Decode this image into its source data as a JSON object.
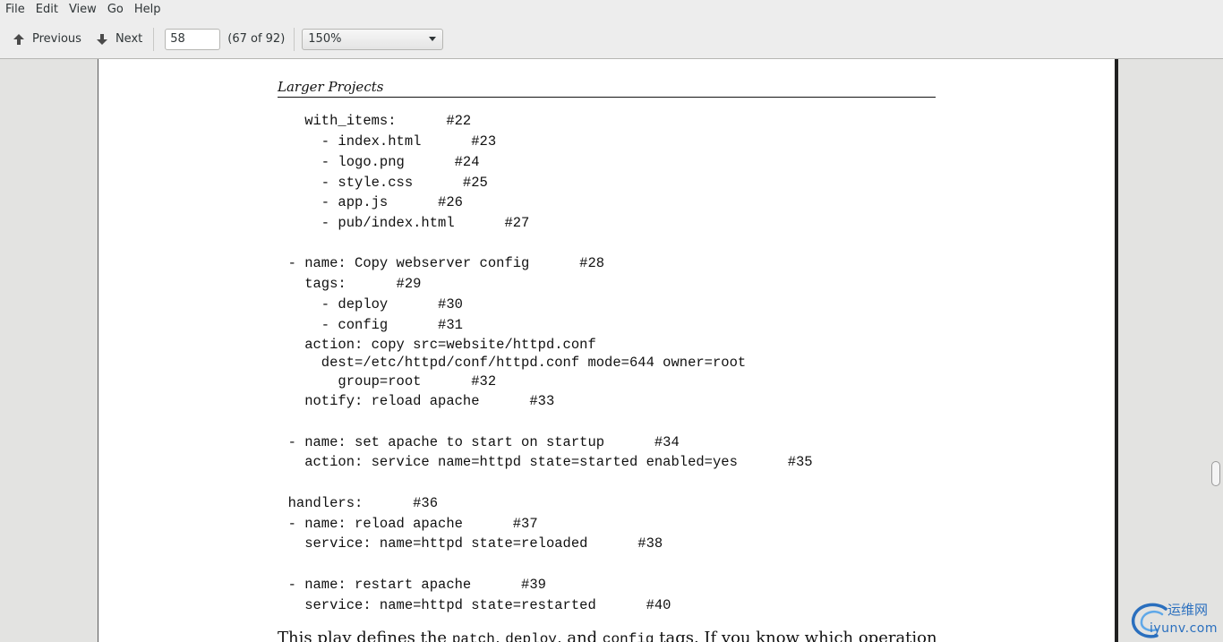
{
  "menubar": {
    "items": [
      "File",
      "Edit",
      "View",
      "Go",
      "Help"
    ]
  },
  "toolbar": {
    "previous_label": "Previous",
    "next_label": "Next",
    "page_input_value": "58",
    "page_count": "(67 of 92)",
    "zoom_value": "150%"
  },
  "document": {
    "running_head": "Larger Projects",
    "code_lines": [
      "    with_items:      #22",
      "      - index.html      #23",
      "      - logo.png      #24",
      "      - style.css      #25",
      "      - app.js      #26",
      "      - pub/index.html      #27",
      "",
      "  - name: Copy webserver config      #28",
      "    tags:      #29",
      "      - deploy      #30",
      "      - config      #31",
      "    action: copy src=website/httpd.conf",
      "      dest=/etc/httpd/conf/httpd.conf mode=644 owner=root",
      "        group=root      #32",
      "    notify: reload apache      #33",
      "",
      "  - name: set apache to start on startup      #34",
      "    action: service name=httpd state=started enabled=yes      #35",
      "",
      "  handlers:      #36",
      "  - name: reload apache      #37",
      "    service: name=httpd state=reloaded      #38",
      "",
      "  - name: restart apache      #39",
      "    service: name=httpd state=restarted      #40"
    ],
    "body_text": {
      "part1": "This play defines the ",
      "code1": "patch",
      "part2": ", ",
      "code2": "deploy",
      "part3": ", and ",
      "code3": "config",
      "part4": " tags. If you know which operation"
    }
  },
  "watermark": {
    "line1": "运维网",
    "line2": "iyunv.com"
  },
  "colors": {
    "toolbar_bg": "#ededed",
    "viewer_bg": "#e3e3e1",
    "page_bg": "#ffffff",
    "watermark": "#2a6fbe"
  }
}
